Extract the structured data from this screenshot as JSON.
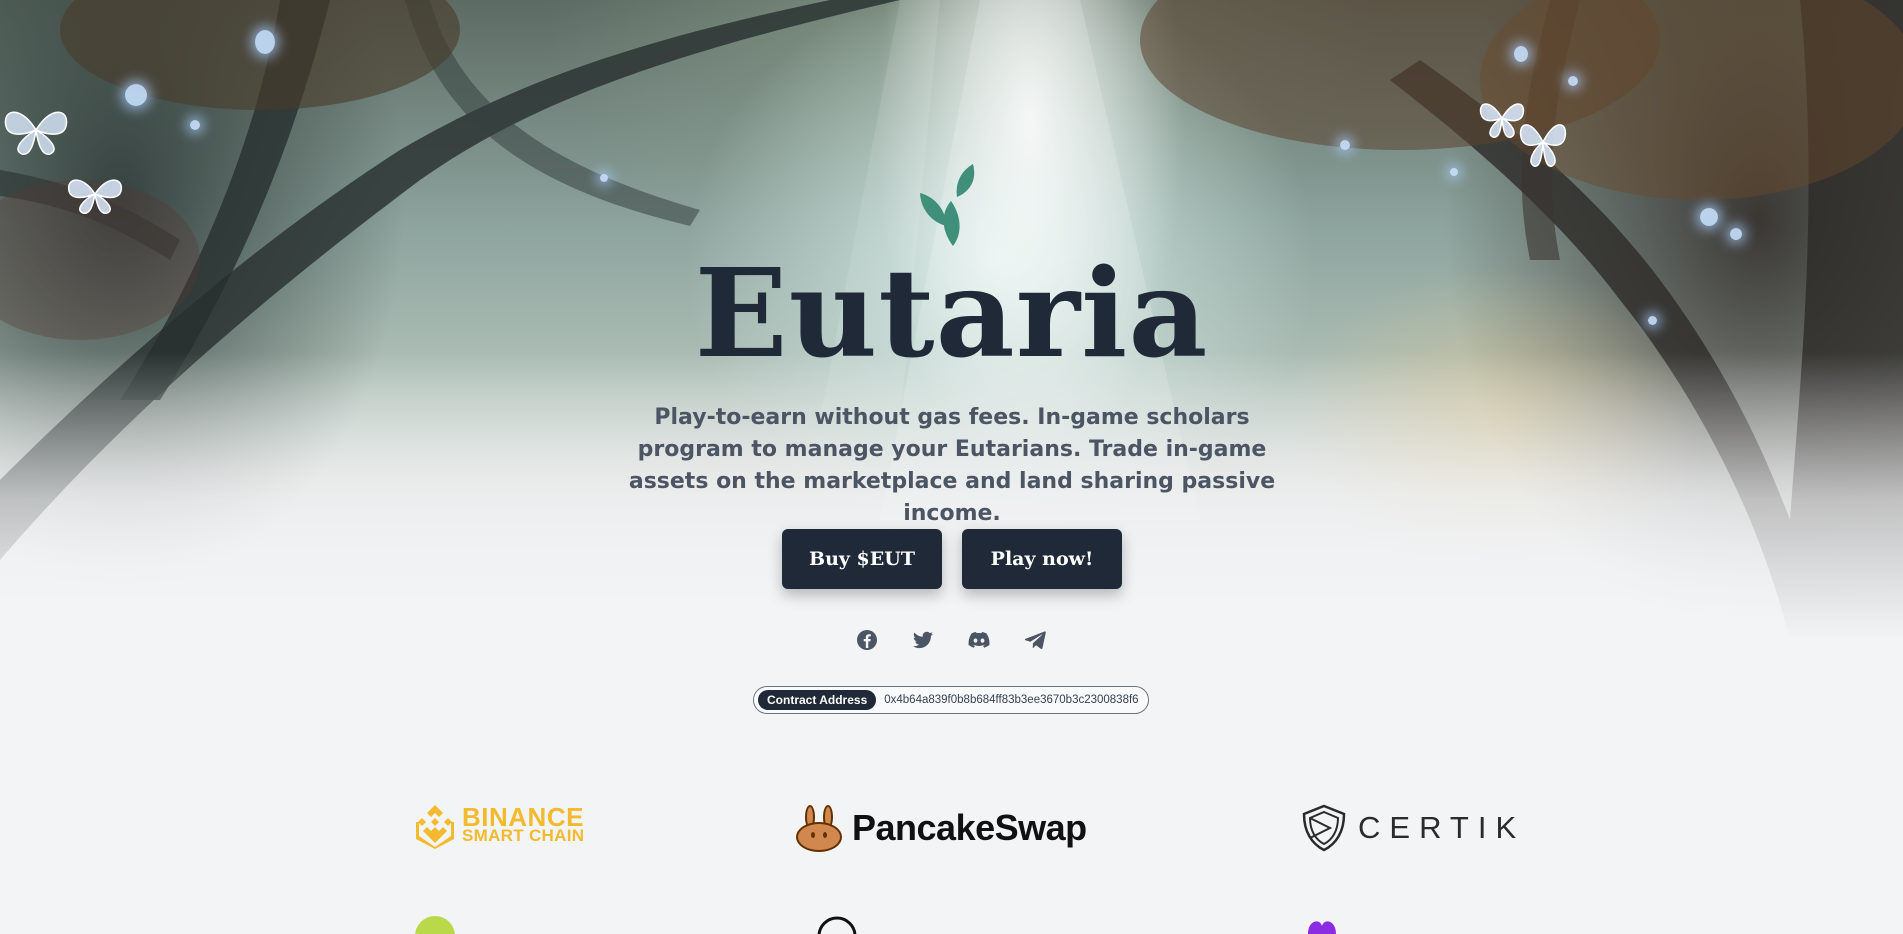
{
  "hero": {
    "title": "Eutaria",
    "tagline": "Play-to-earn without gas fees. In-game scholars program to manage your Eutarians. Trade in-game assets on the marketplace and land sharing passive income.",
    "buttons": {
      "buy_label": "Buy $EUT",
      "play_label": "Play now!"
    }
  },
  "social_links": [
    {
      "name": "facebook-icon"
    },
    {
      "name": "twitter-icon"
    },
    {
      "name": "discord-icon"
    },
    {
      "name": "telegram-icon"
    }
  ],
  "contract": {
    "label": "Contract Address",
    "address": "0x4b64a839f0b8b684ff83b3ee3670b3c2300838f6"
  },
  "partners": {
    "binance": {
      "line1": "BINANCE",
      "line2": "SMART CHAIN"
    },
    "pancakeswap": {
      "name": "PancakeSwap"
    },
    "certik": {
      "name": "CERTIK"
    }
  },
  "colors": {
    "primary_dark": "#1f2937",
    "leaf_green": "#3f8f7a",
    "binance_yellow": "#f3ba2f",
    "page_background": "#f3f4f6"
  }
}
